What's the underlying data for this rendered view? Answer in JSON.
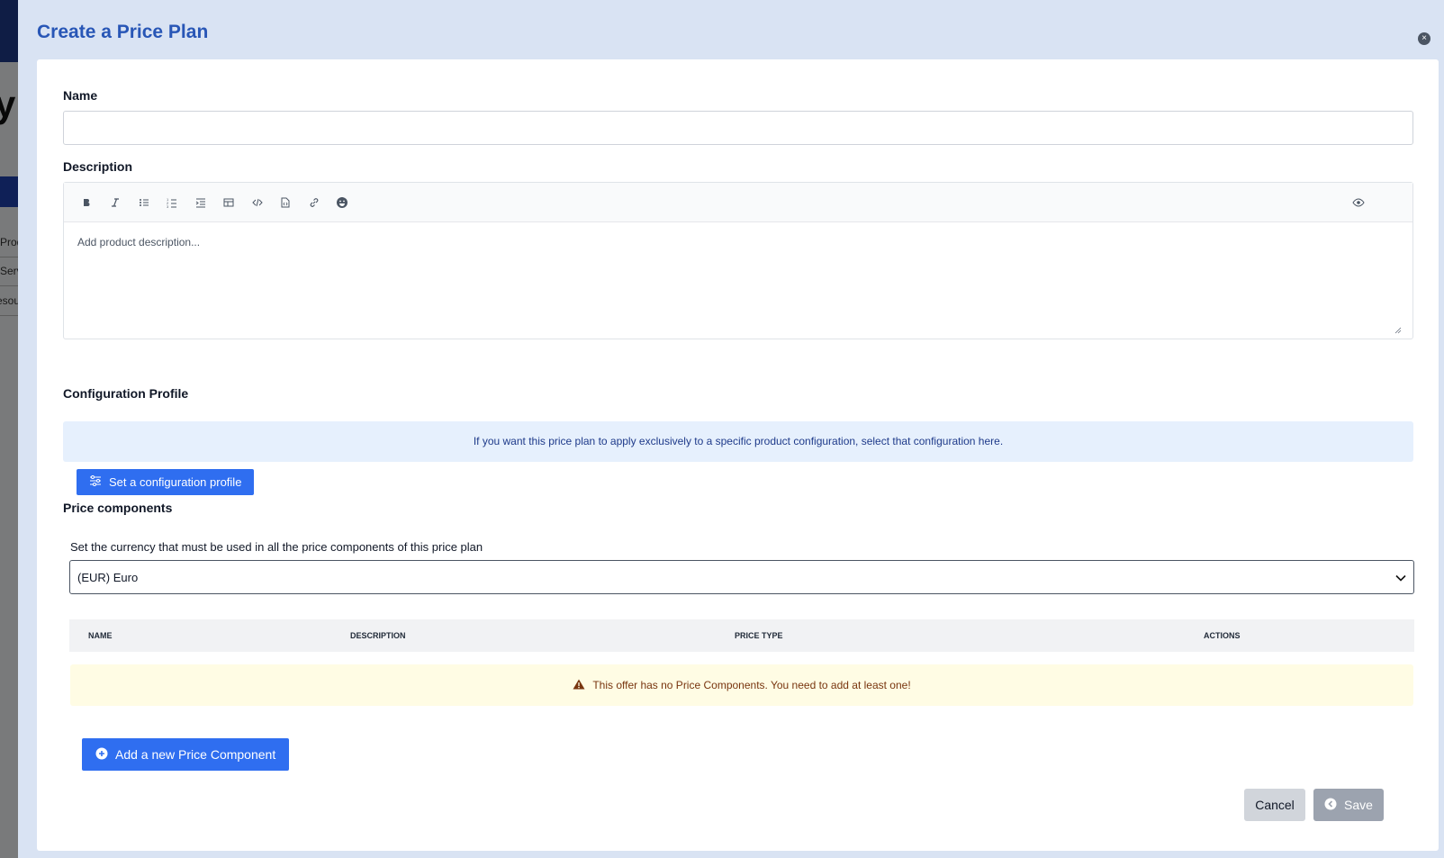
{
  "modal": {
    "title": "Create a Price Plan",
    "close_label": "×"
  },
  "form": {
    "name_label": "Name",
    "name_value": "",
    "description_label": "Description",
    "description_placeholder": "Add product description...",
    "toolbar_icons": [
      "bold-icon",
      "italic-icon",
      "bulleted-list-icon",
      "numbered-list-icon",
      "indent-icon",
      "table-icon",
      "code-icon",
      "code-block-icon",
      "link-icon",
      "emoji-icon"
    ],
    "preview_icon": "eye-icon",
    "config_label": "Configuration Profile",
    "config_info": "If you want this price plan to apply exclusively to a specific product configuration, select that configuration here.",
    "config_button": "Set a configuration profile",
    "price_components_label": "Price components",
    "currency_hint": "Set the currency that must be used in all the price components of this price plan",
    "currency_value": "(EUR) Euro"
  },
  "table": {
    "headers": [
      "NAME",
      "DESCRIPTION",
      "PRICE TYPE",
      "ACTIONS"
    ]
  },
  "warning": {
    "text": "This offer has no Price Components. You need to add at least one!",
    "color": "#78350f"
  },
  "actions": {
    "add_component": "Add a new Price Component",
    "cancel": "Cancel",
    "save": "Save"
  },
  "background": {
    "title_fragment": "y",
    "links": [
      "Prod",
      "Serv",
      "esou"
    ]
  },
  "colors": {
    "accent": "#2f6ef0",
    "title": "#2856b6",
    "modal_bg": "#d9e3f3"
  }
}
